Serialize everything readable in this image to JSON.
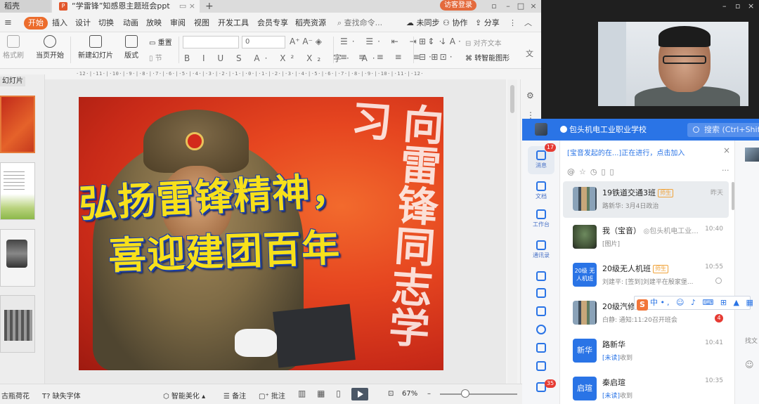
{
  "wps": {
    "tab_left": "稻壳",
    "tab_doc": "“学雷锋”知感恩主题班会ppt",
    "login": "访客登录",
    "menu": [
      "开始",
      "插入",
      "设计",
      "切换",
      "动画",
      "放映",
      "审阅",
      "视图",
      "开发工具",
      "会员专享",
      "稻壳资源"
    ],
    "search_cmd": "查找命令...",
    "right_menu": [
      "未同步",
      "协作",
      "分享"
    ],
    "ribbon": {
      "format_painter": "格式刷",
      "play_from_current": "当页开始",
      "new_slide": "新建幻灯片",
      "layout": "版式",
      "reset": "重置",
      "section": "节",
      "font_size": "0",
      "align_text": "对齐文本",
      "convert_shape": "转智能图形"
    },
    "ruler_text": "·12·|·11·|·10·|·9·|·8·|·7·|·6·|·5·|·4·|·3·|·2·|·1·|·0·|·1·|·2·|·3·|·4·|·5·|·6·|·7·|·8·|·9·|·10·|·11·|·12·",
    "thumbs_label": "幻灯片",
    "slide": {
      "title_line1": "弘扬雷锋精神，",
      "title_line2": "喜迎建团百年",
      "calligraphy": "向雷锋同志学习"
    },
    "status": {
      "theme": "古瓶荷花",
      "missing_font": "缺失字体",
      "beautify": "智能美化",
      "notes": "备注",
      "annotate": "批注",
      "zoom": "67%"
    }
  },
  "chat": {
    "org": "包头机电工业职业学校",
    "search_placeholder": "搜索 (Ctrl+Shif",
    "notice": "[宝音发起的在...]正在进行，点击加入",
    "nav": [
      {
        "label": "消息",
        "badge": "17"
      },
      {
        "label": "文档"
      },
      {
        "label": "工作台"
      },
      {
        "label": "通讯录"
      },
      {
        "badge": "35"
      }
    ],
    "conversations": [
      {
        "title": "19铁道交通3班",
        "tag": "师生",
        "time": "昨天",
        "sub": "路新华: 3月4日政治"
      },
      {
        "title": "我（宝音）",
        "org": "◎包头机电工业...",
        "time": "10:40",
        "sub": "[图片]"
      },
      {
        "title": "20级无人机班",
        "tag": "师生",
        "time": "10:55",
        "sub": "刘建平: [签到]刘建平在殷家堡...",
        "avatar_text": "20级 无人机班"
      },
      {
        "title": "20级汽修",
        "time": "",
        "sub": "白静: 通知:11:20召开班会",
        "badge": "4"
      },
      {
        "title": "路新华",
        "time": "10:41",
        "unread": "[未读]",
        "sub": "收到",
        "avatar_text": "新华"
      },
      {
        "title": "秦启瑄",
        "time": "10:35",
        "unread": "[未读]",
        "sub": "收到",
        "avatar_text": "启瑄"
      }
    ],
    "side_text": "找文"
  },
  "ime": {
    "logo": "S",
    "mode": "中"
  },
  "colors": {
    "wps_accent": "#ec6c2c",
    "chat_blue": "#2a74e6",
    "badge_red": "#e63b33",
    "slide_title_yellow": "#f7e01b"
  }
}
